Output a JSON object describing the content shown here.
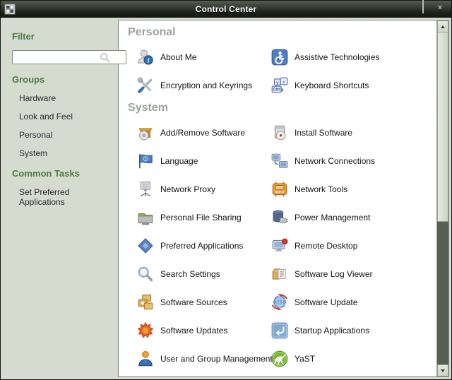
{
  "window": {
    "title": "Control Center",
    "app_icon": "control-center-grid",
    "controls": [
      {
        "name": "minimize",
        "icon": "minimize-icon"
      },
      {
        "name": "maximize",
        "icon": "maximize-icon"
      },
      {
        "name": "close",
        "icon": "close-icon"
      }
    ]
  },
  "sidebar": {
    "filter_label": "Filter",
    "filter_value": "",
    "search_icon": "magnifier",
    "sections": [
      {
        "title": "Groups",
        "items": [
          "Hardware",
          "Look and Feel",
          "Personal",
          "System"
        ]
      },
      {
        "title": "Common Tasks",
        "items": [
          "Set Preferred Applications"
        ]
      }
    ]
  },
  "main": {
    "sections": [
      {
        "title": "Personal",
        "items": [
          {
            "label": "About Me",
            "icon": "about-me"
          },
          {
            "label": "Assistive Technologies",
            "icon": "assistive-technologies"
          },
          {
            "label": "Encryption and Keyrings",
            "icon": "encryption-keyrings"
          },
          {
            "label": "Keyboard Shortcuts",
            "icon": "keyboard-shortcuts"
          }
        ]
      },
      {
        "title": "System",
        "items": [
          {
            "label": "Add/Remove Software",
            "icon": "add-remove-software"
          },
          {
            "label": "Install Software",
            "icon": "install-software"
          },
          {
            "label": "Language",
            "icon": "language"
          },
          {
            "label": "Network Connections",
            "icon": "network-connections"
          },
          {
            "label": "Network Proxy",
            "icon": "network-proxy"
          },
          {
            "label": "Network Tools",
            "icon": "network-tools"
          },
          {
            "label": "Personal File Sharing",
            "icon": "personal-file-sharing"
          },
          {
            "label": "Power Management",
            "icon": "power-management"
          },
          {
            "label": "Preferred Applications",
            "icon": "preferred-applications"
          },
          {
            "label": "Remote Desktop",
            "icon": "remote-desktop"
          },
          {
            "label": "Search Settings",
            "icon": "search-settings"
          },
          {
            "label": "Software Log Viewer",
            "icon": "software-log-viewer"
          },
          {
            "label": "Software Sources",
            "icon": "software-sources"
          },
          {
            "label": "Software Update",
            "icon": "software-update"
          },
          {
            "label": "Software Updates",
            "icon": "software-updates"
          },
          {
            "label": "Startup Applications",
            "icon": "startup-applications"
          },
          {
            "label": "User and Group Management",
            "icon": "user-group-management"
          },
          {
            "label": "YaST",
            "icon": "yast"
          }
        ]
      }
    ]
  },
  "scrollbar": {
    "orientation": "vertical",
    "thumb_position": "top",
    "thumb_fraction": 0.57
  },
  "colors": {
    "titlebar_top": "#555c50",
    "titlebar_bottom": "#15180f",
    "sidebar_bg": "#d6dbd0",
    "heading_green": "#4e7b46",
    "section_header_gray": "#9aa399",
    "content_bg": "#ffffff",
    "scrollbar_trough": "#585d55",
    "item_text": "#141414"
  }
}
